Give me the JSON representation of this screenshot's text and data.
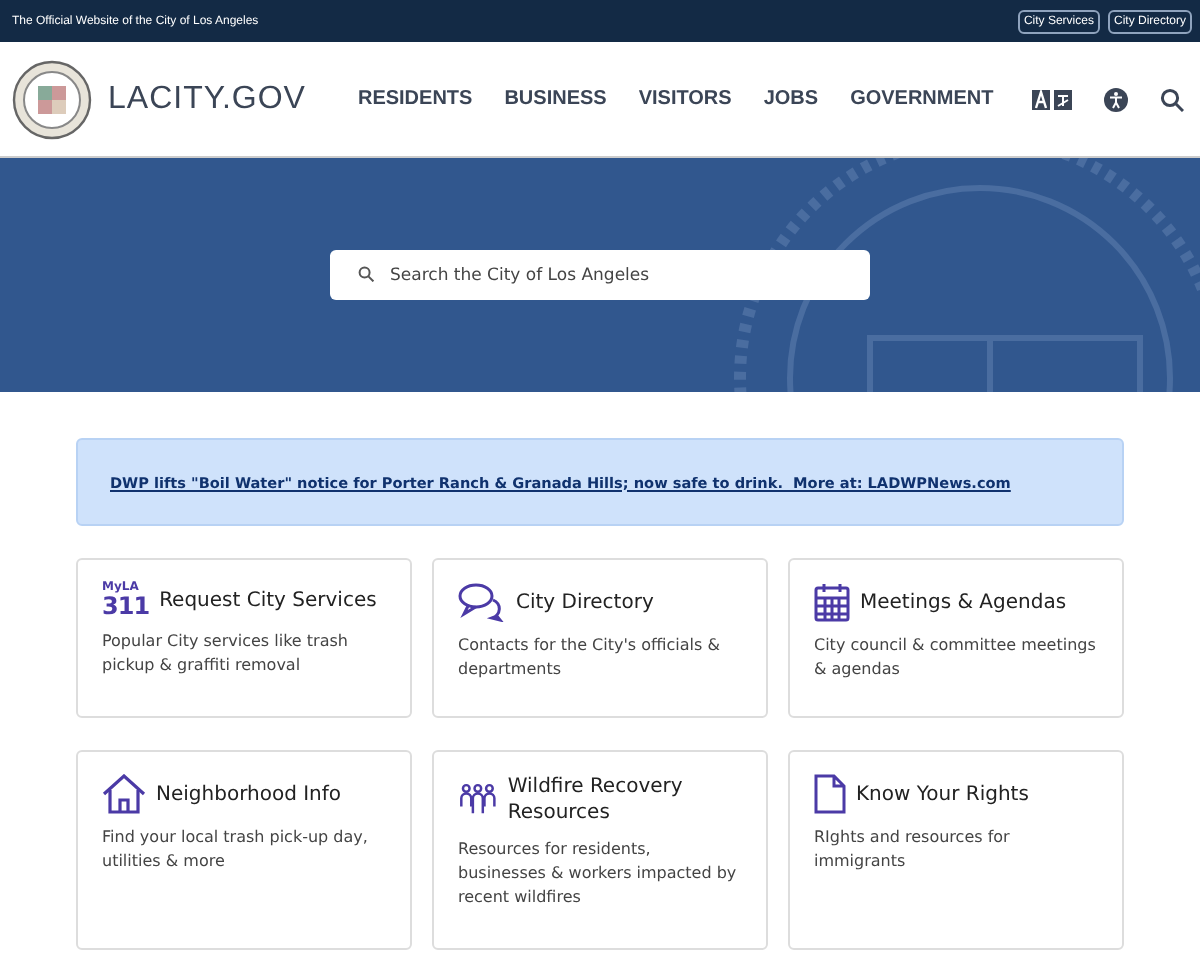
{
  "top_bar": {
    "text": "The Official Website of the City of Los Angeles",
    "links": [
      "City Services",
      "City Directory"
    ]
  },
  "header": {
    "site_name": "LACITY.GOV",
    "nav": [
      "RESIDENTS",
      "BUSINESS",
      "VISITORS",
      "JOBS",
      "GOVERNMENT"
    ]
  },
  "search": {
    "placeholder": "Search the City of Los Angeles"
  },
  "alert": {
    "text": "DWP lifts \"Boil Water\" notice for Porter Ranch & Granada Hills; now safe to drink.  More at: LADWPNews.com"
  },
  "cards": [
    {
      "kind": "myla311",
      "logo_text": [
        "MyLA",
        "311"
      ],
      "title": "Request City Services",
      "text": "Popular City services like trash pickup & graffiti removal"
    },
    {
      "kind": "chat",
      "title": "City Directory",
      "text": "Contacts for the City's officials & departments"
    },
    {
      "kind": "calendar",
      "title": "Meetings & Agendas",
      "text": "City council & committee meetings & agendas"
    },
    {
      "kind": "home",
      "title": "Neighborhood Info",
      "text": "Find your local trash pick-up day, utilities & more"
    },
    {
      "kind": "people",
      "title": "Wildfire Recovery Resources",
      "text": "Resources for residents, businesses & workers impacted by recent wildfires"
    },
    {
      "kind": "document",
      "title": "Know Your Rights",
      "text": "RIghts and resources for immigrants"
    }
  ]
}
